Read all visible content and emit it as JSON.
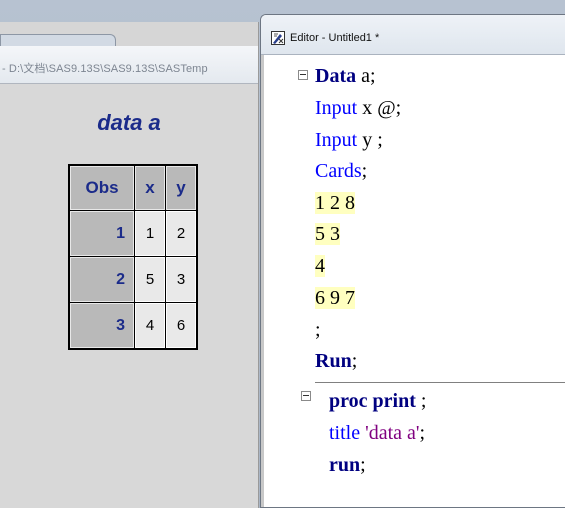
{
  "results_window": {
    "title": "- D:\\文档\\SAS9.13S\\SAS9.13S\\SASTemp",
    "output_title": "data a",
    "table": {
      "headers": [
        "Obs",
        "x",
        "y"
      ],
      "rows": [
        {
          "obs": "1",
          "x": "1",
          "y": "2"
        },
        {
          "obs": "2",
          "x": "5",
          "y": "3"
        },
        {
          "obs": "3",
          "x": "4",
          "y": "6"
        }
      ]
    }
  },
  "editor": {
    "title": "Editor - Untitled1 *",
    "icon": "editor-icon",
    "code": {
      "l1_kw": "Data",
      "l1_rest": " a;",
      "l2_kw": "Input",
      "l2_rest": " x @;",
      "l3_kw": "Input",
      "l3_rest": " y ;",
      "l4_kw": "Cards",
      "l4_rest": ";",
      "d1": "1 2 8",
      "d2": "5 3",
      "d3": "4",
      "d4": "6 9 7",
      "l9": ";",
      "l10_kw": "Run",
      "l10_rest": ";",
      "l11_kw": "proc print",
      "l11_rest": " ;",
      "l12_kw": "title",
      "l12_str": " 'data a'",
      "l12_rest": ";",
      "l13_kw": "run",
      "l13_rest": ";"
    }
  },
  "colors": {
    "keyword_step": "#000080",
    "keyword": "#0000ff",
    "string": "#800080",
    "datalines_bg": "#ffffc0",
    "header_text": "#1b2b8a"
  }
}
